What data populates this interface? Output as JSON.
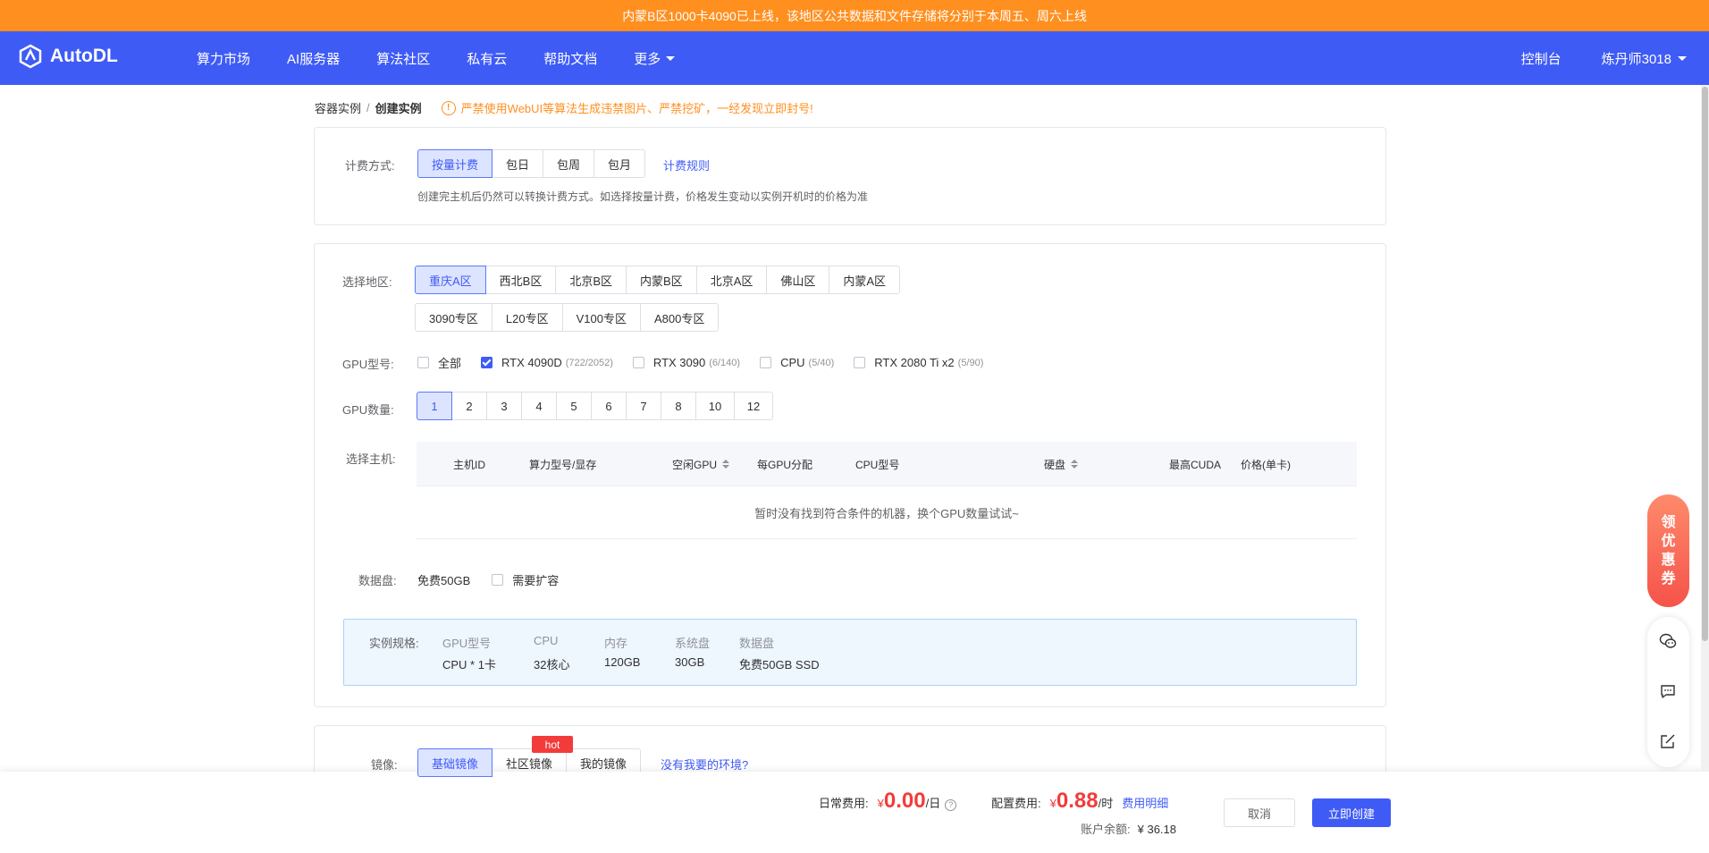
{
  "banner": {
    "text": "内蒙B区1000卡4090已上线，该地区公共数据和文件存储将分别于本周五、周六上线"
  },
  "nav": {
    "brand": "AutoDL",
    "items": [
      "算力市场",
      "AI服务器",
      "算法社区",
      "私有云",
      "帮助文档",
      "更多"
    ],
    "console": "控制台",
    "user": "炼丹师3018"
  },
  "breadcrumb": {
    "parent": "容器实例",
    "separator": "/",
    "current": "创建实例"
  },
  "warning": "严禁使用WebUI等算法生成违禁图片、严禁挖矿，一经发现立即封号!",
  "billing": {
    "label": "计费方式:",
    "options": [
      "按量计费",
      "包日",
      "包周",
      "包月"
    ],
    "selected": "按量计费",
    "rules_link": "计费规则",
    "note": "创建完主机后仍然可以转换计费方式。如选择按量计费，价格发生变动以实例开机时的价格为准"
  },
  "region": {
    "label": "选择地区:",
    "row1": [
      "重庆A区",
      "西北B区",
      "北京B区",
      "内蒙B区",
      "北京A区",
      "佛山区",
      "内蒙A区"
    ],
    "row2": [
      "3090专区",
      "L20专区",
      "V100专区",
      "A800专区"
    ],
    "selected": "重庆A区"
  },
  "gpu_type": {
    "label": "GPU型号:",
    "options": [
      {
        "name": "全部",
        "count": "",
        "checked": false
      },
      {
        "name": "RTX 4090D",
        "count": "(722/2052)",
        "checked": true
      },
      {
        "name": "RTX 3090",
        "count": "(6/140)",
        "checked": false
      },
      {
        "name": "CPU",
        "count": "(5/40)",
        "checked": false
      },
      {
        "name": "RTX 2080 Ti x2",
        "count": "(5/90)",
        "checked": false
      }
    ]
  },
  "gpu_count": {
    "label": "GPU数量:",
    "options": [
      "1",
      "2",
      "3",
      "4",
      "5",
      "6",
      "7",
      "8",
      "10",
      "12"
    ],
    "selected": "1"
  },
  "host": {
    "label": "选择主机:",
    "columns": [
      "主机ID",
      "算力型号/显存",
      "空闲GPU",
      "每GPU分配",
      "CPU型号",
      "硬盘",
      "最高CUDA",
      "价格(单卡)"
    ],
    "empty_text": "暂时没有找到符合条件的机器，换个GPU数量试试~"
  },
  "disk": {
    "label": "数据盘:",
    "free": "免费50GB",
    "expand": "需要扩容"
  },
  "spec": {
    "label": "实例规格:",
    "keys": [
      "GPU型号",
      "CPU",
      "内存",
      "系统盘",
      "数据盘"
    ],
    "values": [
      "CPU * 1卡",
      "32核心",
      "120GB",
      "30GB",
      "免费50GB SSD"
    ]
  },
  "image": {
    "label": "镜像:",
    "options": [
      "基础镜像",
      "社区镜像",
      "我的镜像"
    ],
    "selected": "基础镜像",
    "hot": "hot",
    "link": "没有我要的环境?"
  },
  "footer": {
    "daily_label": "日常费用:",
    "currency": "¥",
    "daily_value": "0.00",
    "daily_unit": "/日",
    "config_label": "配置费用:",
    "config_value": "0.88",
    "config_unit": "/时",
    "detail_link": "费用明细",
    "balance_label": "账户余额:",
    "balance_value": "¥ 36.18",
    "cancel": "取消",
    "create": "立即创建"
  },
  "side": {
    "coupon": [
      "领",
      "优",
      "惠",
      "券"
    ]
  }
}
